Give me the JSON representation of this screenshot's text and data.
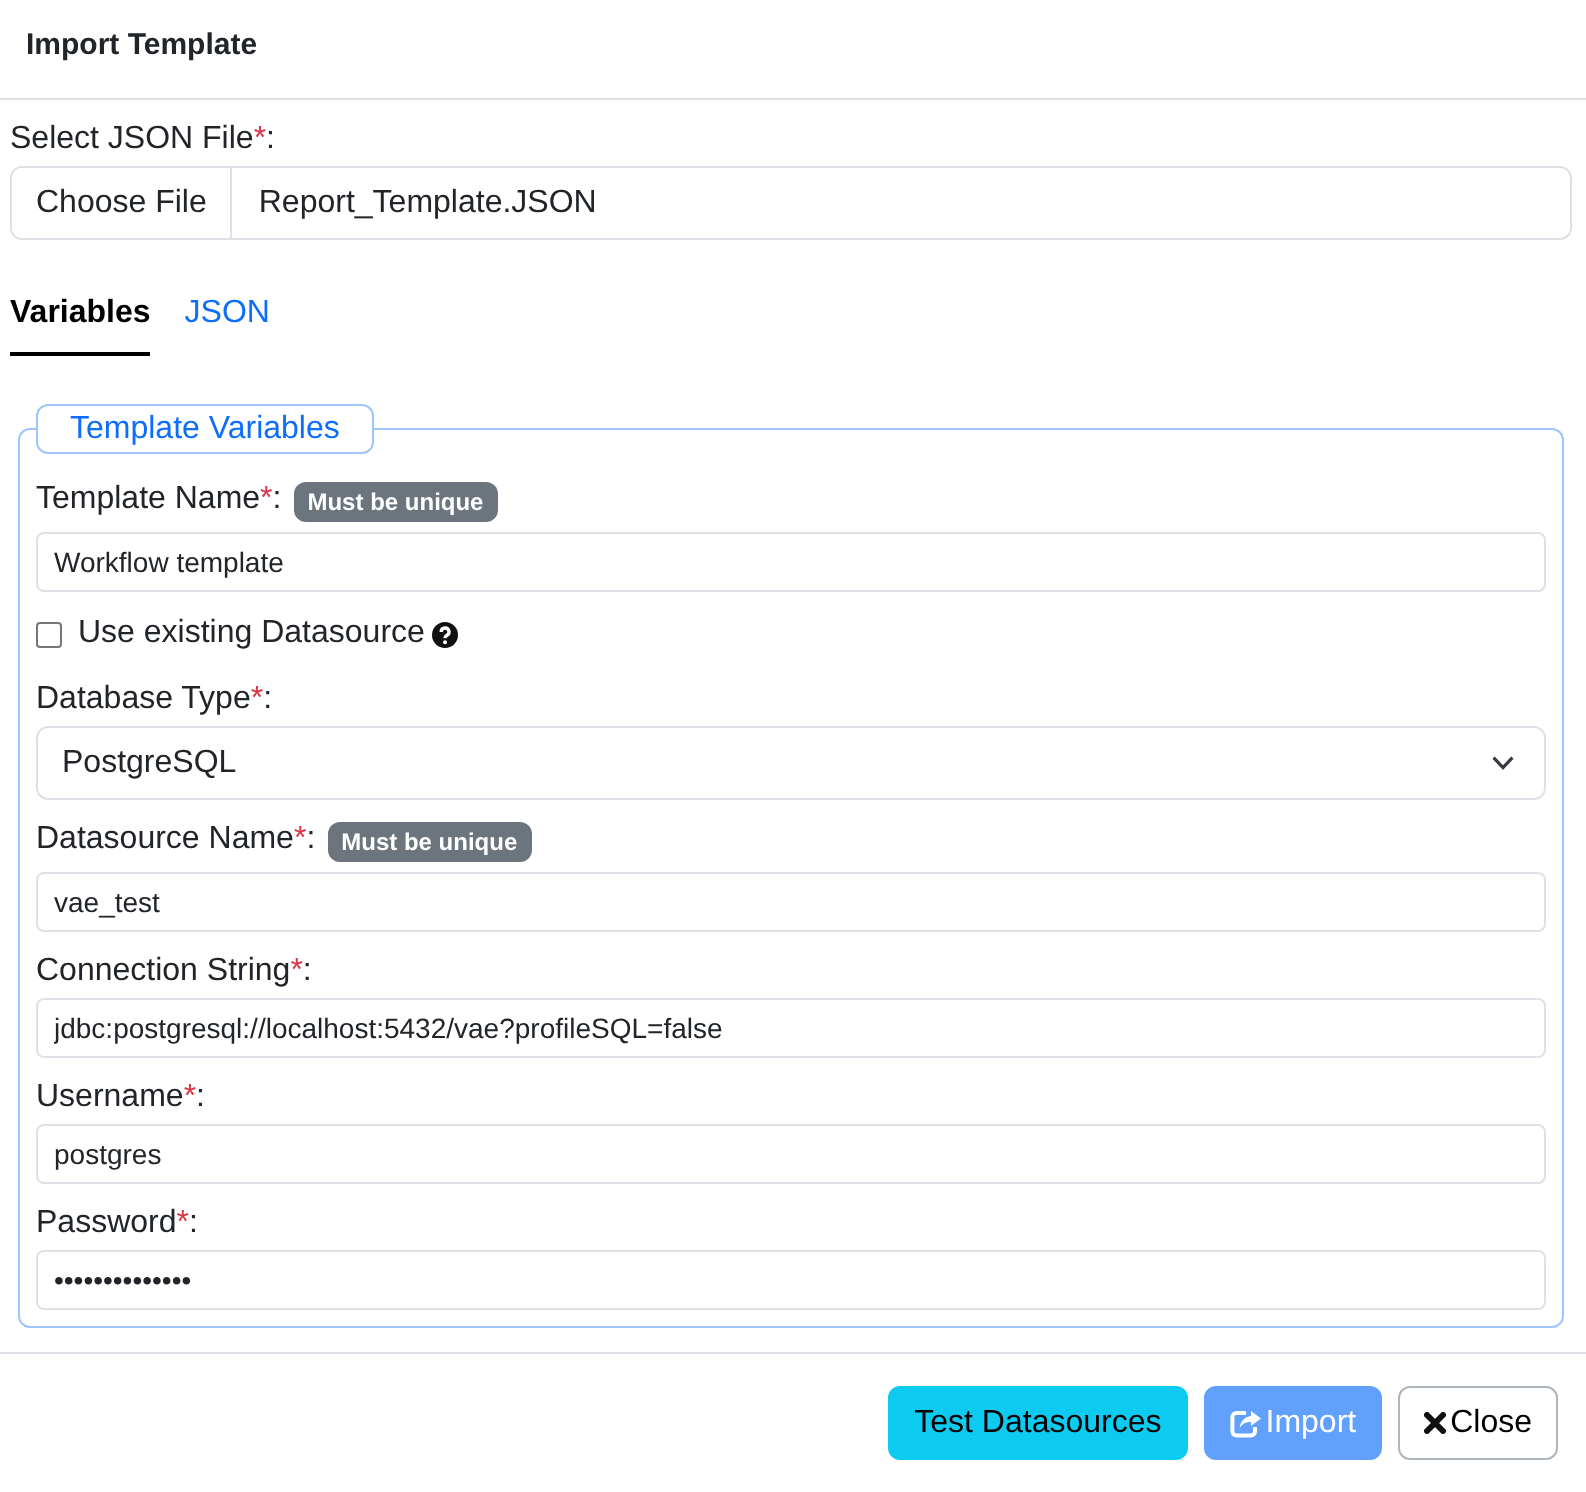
{
  "dialog": {
    "title": "Import Template"
  },
  "file_picker": {
    "label": "Select JSON File",
    "required_mark": "*",
    "separator": ":",
    "button": "Choose File",
    "file_name": "Report_Template.JSON"
  },
  "tabs": [
    {
      "label": "Variables",
      "selected": true
    },
    {
      "label": "JSON",
      "selected": false
    }
  ],
  "template_variables": {
    "legend": "Template Variables",
    "fields": [
      {
        "kind": "text",
        "label": "Template Name",
        "required_mark": "*",
        "separator": ":",
        "badge": "Must be unique",
        "value": "Workflow template"
      },
      {
        "kind": "checkbox",
        "label": "Use existing Datasource",
        "checked": false
      },
      {
        "kind": "select",
        "label": "Database Type",
        "required_mark": "*",
        "separator": ":",
        "value": "PostgreSQL"
      },
      {
        "kind": "text",
        "label": "Datasource Name",
        "required_mark": "*",
        "separator": ":",
        "badge": "Must be unique",
        "value": "vae_test"
      },
      {
        "kind": "text",
        "label": "Connection String",
        "required_mark": "*",
        "separator": ":",
        "value": "jdbc:postgresql://localhost:5432/vae?profileSQL=false"
      },
      {
        "kind": "text",
        "label": "Username",
        "required_mark": "*",
        "separator": ":",
        "value": "postgres"
      },
      {
        "kind": "password",
        "label": "Password",
        "required_mark": "*",
        "separator": ":",
        "value": "••••••••••••••"
      }
    ]
  },
  "buttons": [
    {
      "label": "Test Datasources",
      "kind": "info",
      "disabled": false
    },
    {
      "label": "Import",
      "kind": "primary",
      "disabled": true
    },
    {
      "label": "Close",
      "kind": "secondary",
      "disabled": false
    }
  ]
}
